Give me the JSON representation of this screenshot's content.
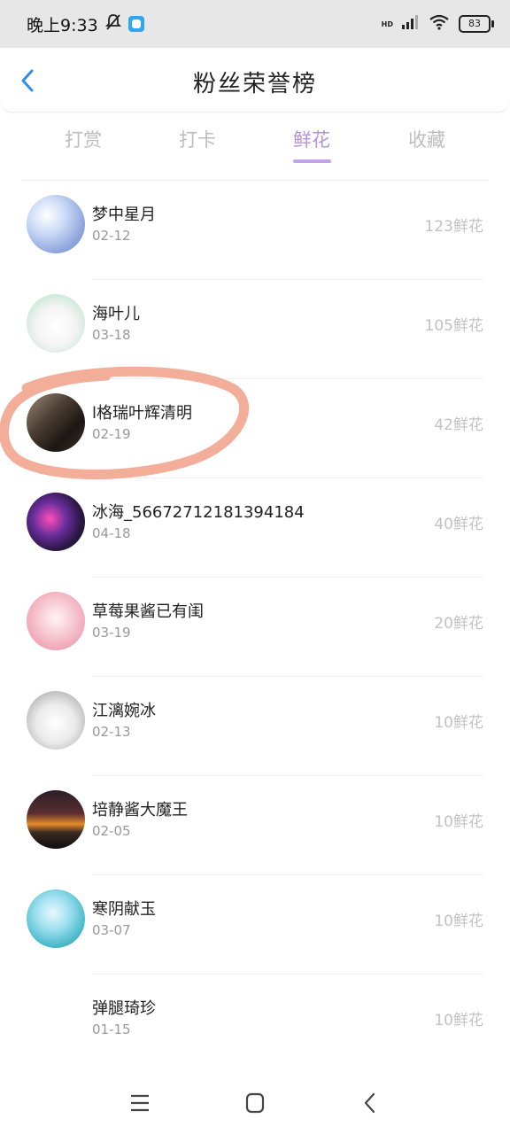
{
  "status_bar": {
    "time": "晚上9:33",
    "battery": "83",
    "network_label": "HD"
  },
  "header": {
    "title": "粉丝荣誉榜"
  },
  "tabs": [
    {
      "label": "打赏",
      "active": false
    },
    {
      "label": "打卡",
      "active": false
    },
    {
      "label": "鲜花",
      "active": true
    },
    {
      "label": "收藏",
      "active": false
    }
  ],
  "fans": [
    {
      "name": "梦中星月",
      "date": "02-12",
      "amount": "123鲜花"
    },
    {
      "name": "海叶儿",
      "date": "03-18",
      "amount": "105鲜花"
    },
    {
      "name": "l格瑞叶辉清明",
      "date": "02-19",
      "amount": "42鲜花"
    },
    {
      "name": "冰海_56672712181394184",
      "date": "04-18",
      "amount": "40鲜花"
    },
    {
      "name": "草莓果酱已有闺",
      "date": "03-19",
      "amount": "20鲜花"
    },
    {
      "name": "江漓婉冰",
      "date": "02-13",
      "amount": "10鲜花"
    },
    {
      "name": "培静酱大魔王",
      "date": "02-05",
      "amount": "10鲜花"
    },
    {
      "name": "寒阴献玉",
      "date": "03-07",
      "amount": "10鲜花"
    },
    {
      "name": "弹腿琦珍",
      "date": "01-15",
      "amount": "10鲜花"
    }
  ],
  "colors": {
    "accent": "#b693d8",
    "highlight_stroke": "#f2a58e",
    "back_arrow": "#2f8fe8"
  }
}
